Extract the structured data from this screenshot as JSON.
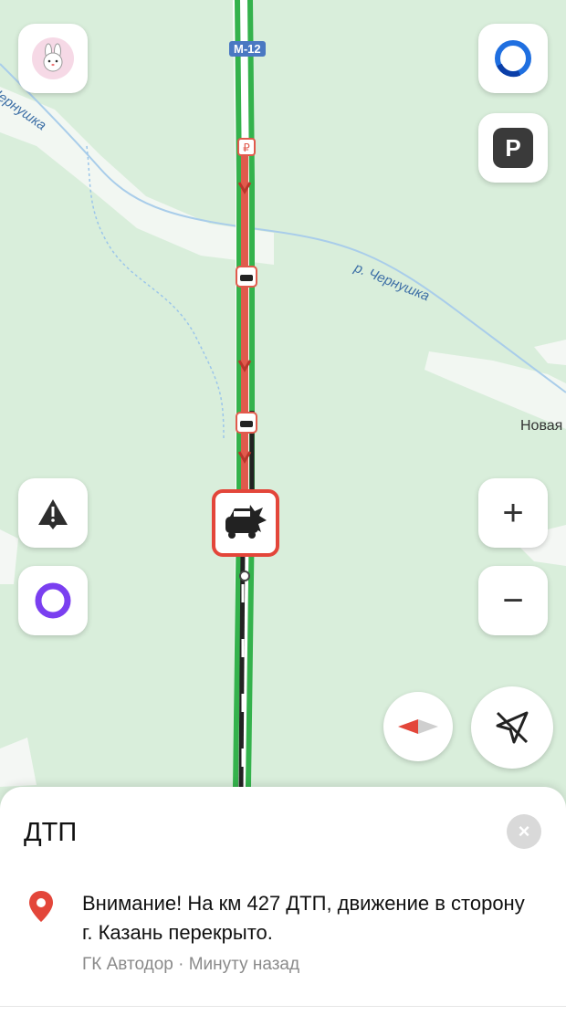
{
  "map": {
    "road_shield": "М-12",
    "river_label_left": "Чернушка",
    "river_label_right": "р. Чернушка",
    "place_label": "Новая"
  },
  "controls": {
    "profile_icon": "rabbit-emoji-icon",
    "alice_top_icon": "alice-ring-icon",
    "parking_label": "P",
    "report_icon": "warning-triangle-icon",
    "alice_icon": "alice-assistant-icon",
    "zoom_in_label": "+",
    "zoom_out_label": "−",
    "compass_icon": "compass-icon",
    "route_icon": "route-off-icon"
  },
  "incident": {
    "title": "ДТП",
    "message": "Внимание! На км 427 ДТП, движение в сторону г. Казань перекрыто.",
    "source": "ГК Автодор",
    "separator": " · ",
    "time": "Минуту назад",
    "close_label": "×"
  },
  "colors": {
    "map_bg": "#d9eedb",
    "road_green": "#34b24c",
    "road_red": "#e05a4c",
    "accent_red": "#e3463a",
    "alice_purple": "#7a3ff0",
    "alice_blue": "#1f6fe0"
  }
}
